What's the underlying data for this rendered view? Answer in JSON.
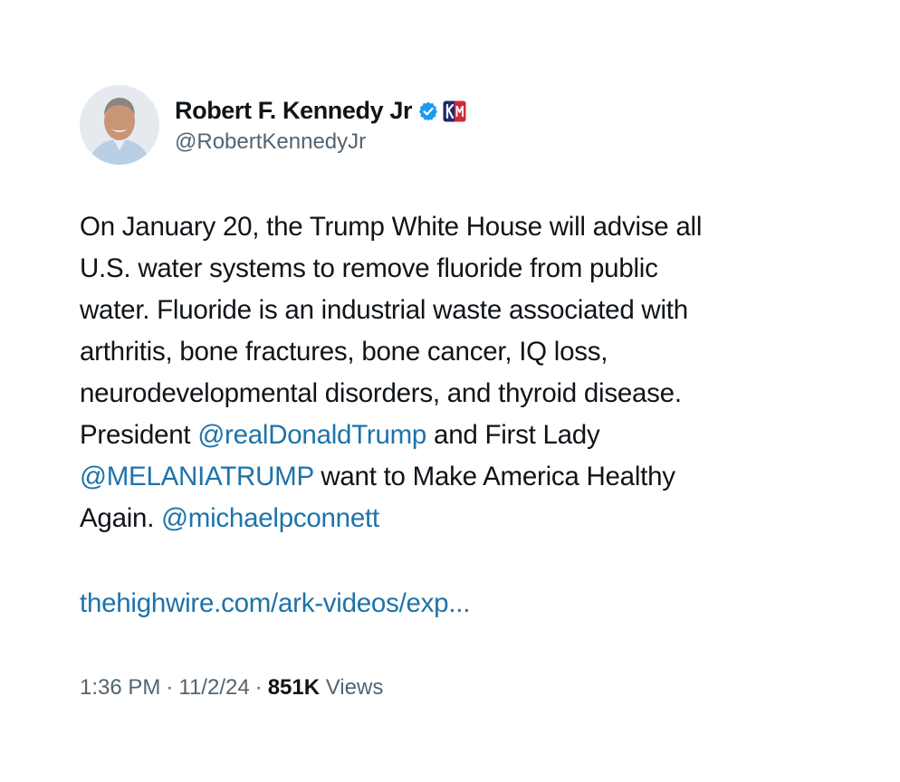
{
  "author": {
    "display_name": "Robert F. Kennedy Jr",
    "handle": "@RobertKennedyJr",
    "verified": true,
    "affiliate_badge_icon": "kennedy-campaign-badge-icon",
    "verified_icon": "verified-badge-icon"
  },
  "tweet": {
    "lines": [
      [
        {
          "t": "text",
          "v": "On January 20, the Trump White House will advise all"
        }
      ],
      [
        {
          "t": "text",
          "v": "U.S. water systems to remove fluoride from public"
        }
      ],
      [
        {
          "t": "text",
          "v": "water. Fluoride is an industrial waste associated with"
        }
      ],
      [
        {
          "t": "text",
          "v": "arthritis, bone fractures, bone cancer, IQ loss,"
        }
      ],
      [
        {
          "t": "text",
          "v": "neurodevelopmental disorders, and thyroid disease."
        }
      ],
      [
        {
          "t": "text",
          "v": "President "
        },
        {
          "t": "mention",
          "v": "@realDonaldTrump"
        },
        {
          "t": "text",
          "v": " and First Lady"
        }
      ],
      [
        {
          "t": "mention",
          "v": "@MELANIATRUMP"
        },
        {
          "t": "text",
          "v": " want to Make America Healthy"
        }
      ],
      [
        {
          "t": "text",
          "v": "Again. "
        },
        {
          "t": "mention",
          "v": "@michaelpconnett"
        }
      ]
    ],
    "link": "thehighwire.com/ark-videos/exp..."
  },
  "meta": {
    "time": "1:36 PM",
    "date": "11/2/24",
    "separator": "·",
    "views_count": "851K",
    "views_label": "Views"
  },
  "colors": {
    "link": "#1d73a8",
    "secondary_text": "#536471",
    "primary_text": "#0f1419",
    "verified": "#1d9bf0"
  }
}
